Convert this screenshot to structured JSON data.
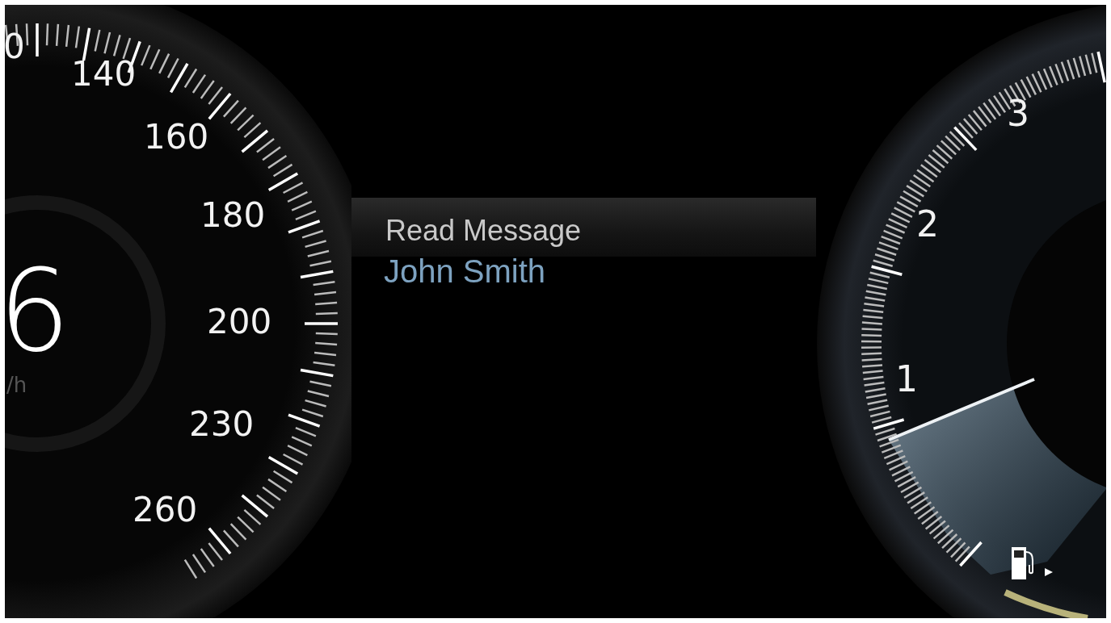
{
  "speedometer": {
    "scale_labels": [
      "0",
      "140",
      "160",
      "180",
      "200",
      "230",
      "260"
    ],
    "speed": "6",
    "unit": "/h"
  },
  "message": {
    "title": "Read Message",
    "sender": "John Smith"
  },
  "tachometer": {
    "scale_labels": [
      "3",
      "2",
      "1"
    ]
  }
}
